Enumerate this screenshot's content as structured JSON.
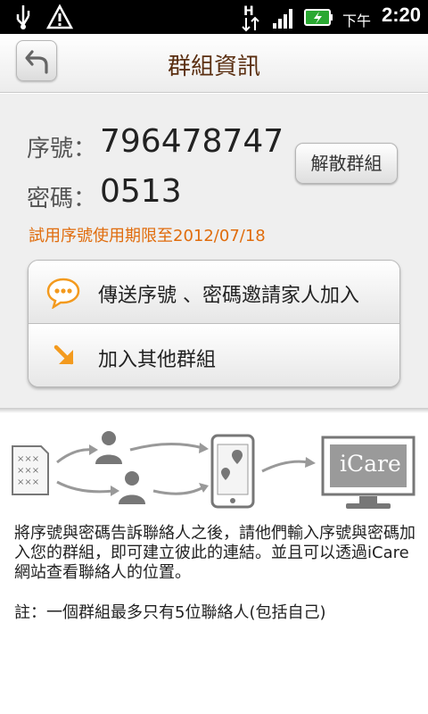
{
  "status_bar": {
    "ampm": "下午",
    "time": "2:20",
    "icons": [
      "usb-icon",
      "warning-icon",
      "hspa-data-icon",
      "signal-icon",
      "battery-charging-icon"
    ]
  },
  "header": {
    "title": "群組資訊",
    "back_icon": "back-arrow-icon"
  },
  "group_info": {
    "serial_label": "序號：",
    "serial_value": "796478747",
    "password_label": "密碼：",
    "password_value": "0513",
    "trial_notice": "試用序號使用期限至2012/07/18",
    "dissolve_button": "解散群組"
  },
  "actions": [
    {
      "label": "傳送序號 、密碼邀請家人加入",
      "icon": "chat-bubble-icon"
    },
    {
      "label": "加入其他群組",
      "icon": "arrow-down-right-icon"
    }
  ],
  "illustration": {
    "logo_text": "iCare"
  },
  "description": "將序號與密碼告訴聯絡人之後，請他們輸入序號與密碼加入您的群組，即可建立彼此的連結。並且可以透過iCare網站查看聯絡人的位置。",
  "note": "註：一個群組最多只有5位聯絡人(包括自己)",
  "colors": {
    "title": "#5a2e10",
    "trial_notice": "#e06c0c",
    "accent_icon": "#f39a1e"
  }
}
